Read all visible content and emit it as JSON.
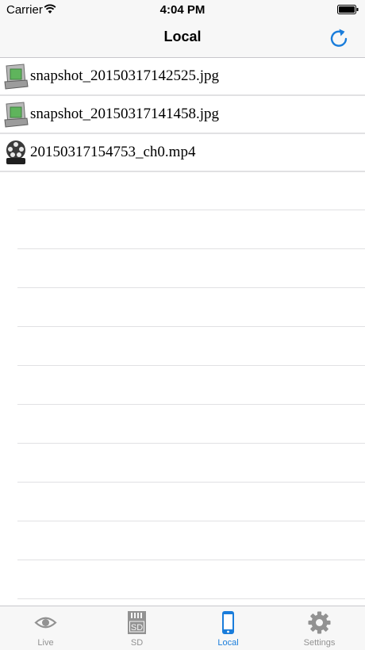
{
  "status_bar": {
    "carrier": "Carrier",
    "time": "4:04 PM"
  },
  "nav": {
    "title": "Local",
    "refresh_icon": "refresh-icon"
  },
  "files": [
    {
      "name": "snapshot_20150317142525.jpg",
      "icon": "image-file-icon"
    },
    {
      "name": "snapshot_20150317141458.jpg",
      "icon": "image-file-icon"
    },
    {
      "name": "20150317154753_ch0.mp4",
      "icon": "video-file-icon"
    }
  ],
  "tabs": [
    {
      "label": "Live",
      "icon": "eye-icon",
      "active": false
    },
    {
      "label": "SD",
      "icon": "sd-card-icon",
      "active": false
    },
    {
      "label": "Local",
      "icon": "phone-icon",
      "active": true
    },
    {
      "label": "Settings",
      "icon": "gear-icon",
      "active": false
    }
  ],
  "colors": {
    "accent": "#1a7ddb",
    "inactive": "#929292",
    "bar_background": "#f7f7f7"
  }
}
